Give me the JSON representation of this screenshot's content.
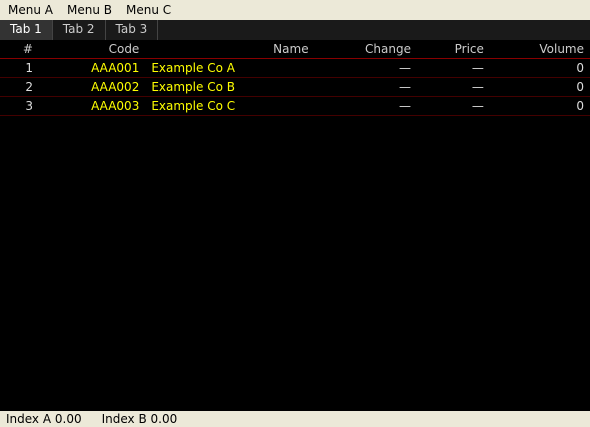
{
  "menu": [
    "Menu A",
    "Menu B",
    "Menu C"
  ],
  "tabs": [
    {
      "label": "Tab 1",
      "active": true
    },
    {
      "label": "Tab 2"
    },
    {
      "label": "Tab 3"
    }
  ],
  "columns": [
    "#",
    "Code",
    "Name",
    "Change",
    "Price",
    "Volume"
  ],
  "rows": [
    {
      "n": "1",
      "code": "AAA001",
      "name": "Example Co A",
      "chg": "—",
      "price": "—",
      "vol": "0"
    },
    {
      "n": "2",
      "code": "AAA002",
      "name": "Example Co B",
      "chg": "—",
      "price": "—",
      "vol": "0"
    },
    {
      "n": "3",
      "code": "AAA003",
      "name": "Example Co C",
      "chg": "—",
      "price": "—",
      "vol": "0"
    }
  ],
  "status": [
    "Index A 0.00",
    "Index B 0.00"
  ]
}
